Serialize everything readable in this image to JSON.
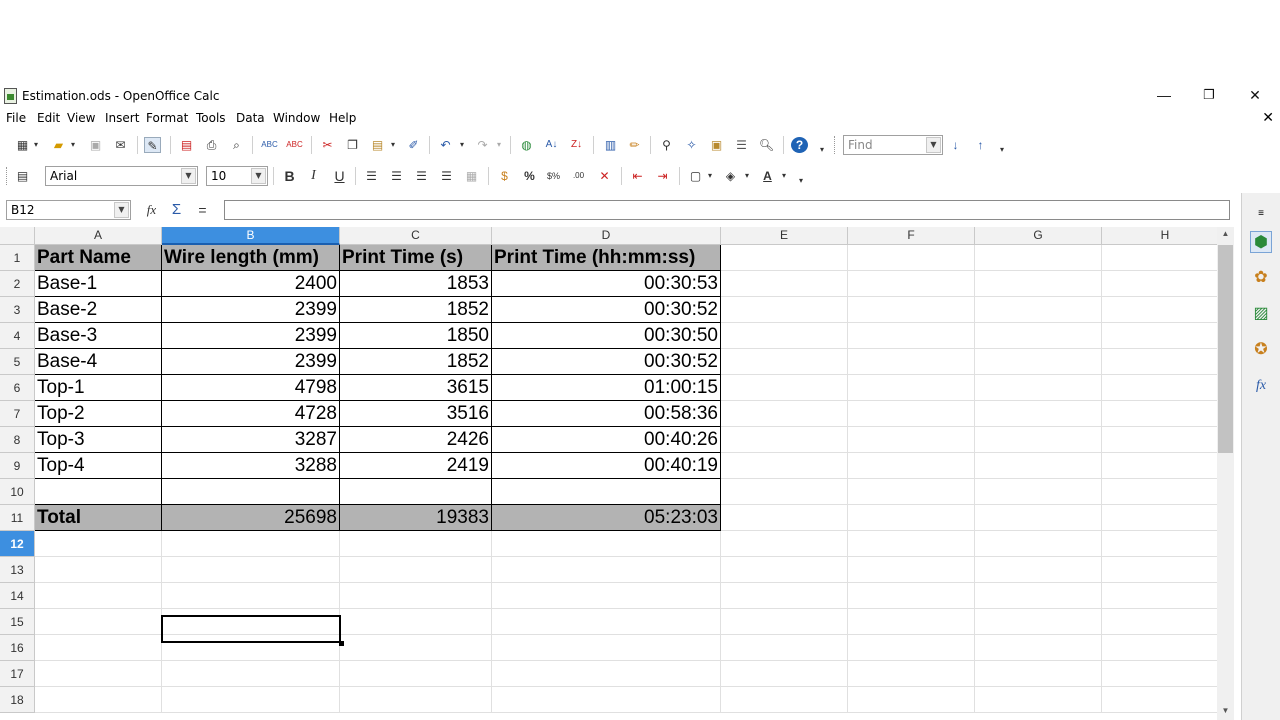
{
  "window": {
    "title": "Estimation.ods - OpenOffice Calc",
    "minimize": "—",
    "restore": "❐",
    "close": "✕"
  },
  "menu": [
    "File",
    "Edit",
    "View",
    "Insert",
    "Format",
    "Tools",
    "Data",
    "Window",
    "Help"
  ],
  "find": {
    "placeholder": "Find"
  },
  "font": {
    "name": "Arial",
    "size": "10"
  },
  "name_box": "B12",
  "formula_bar": {
    "function_wizard": "fx",
    "sum": "Σ",
    "equals": "=",
    "value": ""
  },
  "columns": [
    "A",
    "B",
    "C",
    "D",
    "E",
    "F",
    "G",
    "H"
  ],
  "selected_column": "B",
  "rows": [
    "1",
    "2",
    "3",
    "4",
    "5",
    "6",
    "7",
    "8",
    "9",
    "10",
    "11",
    "12",
    "13",
    "14",
    "15",
    "16",
    "17",
    "18"
  ],
  "selected_row": "12",
  "table": {
    "headers": [
      "Part Name",
      "Wire length (mm)",
      "Print Time (s)",
      "Print Time (hh:mm:ss)"
    ],
    "data": [
      [
        "Base-1",
        "2400",
        "1853",
        "00:30:53"
      ],
      [
        "Base-2",
        "2399",
        "1852",
        "00:30:52"
      ],
      [
        "Base-3",
        "2399",
        "1850",
        "00:30:50"
      ],
      [
        "Base-4",
        "2399",
        "1852",
        "00:30:52"
      ],
      [
        "Top-1",
        "4798",
        "3615",
        "01:00:15"
      ],
      [
        "Top-2",
        "4728",
        "3516",
        "00:58:36"
      ],
      [
        "Top-3",
        "3287",
        "2426",
        "00:40:26"
      ],
      [
        "Top-4",
        "3288",
        "2419",
        "00:40:19"
      ]
    ],
    "total": [
      "Total",
      "25698",
      "19383",
      "05:23:03"
    ]
  },
  "colors": {
    "header_fill": "#b3b3b3",
    "selection": "#3d8fe0"
  },
  "icons": {
    "standard": [
      "new-icon",
      "open-icon",
      "save-icon",
      "email-icon",
      "edit-file-icon",
      "pdf-icon",
      "print-icon",
      "print-preview-icon",
      "spellcheck-icon",
      "autospell-icon",
      "cut-icon",
      "copy-icon",
      "paste-icon",
      "clone-formatting-icon",
      "undo-icon",
      "redo-icon",
      "hyperlink-icon",
      "sort-ascending-icon",
      "sort-descending-icon",
      "chart-icon",
      "draw-icon",
      "find-replace-icon",
      "navigator-icon",
      "gallery-icon",
      "datasources-icon",
      "zoom-icon",
      "help-icon"
    ],
    "formatting": [
      "styles-icon",
      "bold-icon",
      "italic-icon",
      "underline-icon",
      "align-left-icon",
      "align-center-icon",
      "align-right-icon",
      "justify-icon",
      "merge-cells-icon",
      "currency-icon",
      "percent-icon",
      "standard-format-icon",
      "add-decimal-icon",
      "delete-decimal-icon",
      "decrease-indent-icon",
      "increase-indent-icon",
      "borders-icon",
      "background-color-icon",
      "font-color-icon"
    ],
    "sidebar": [
      "properties-icon",
      "styles-formatting-icon",
      "gallery-sidebar-icon",
      "navigator-sidebar-icon",
      "functions-icon"
    ]
  }
}
